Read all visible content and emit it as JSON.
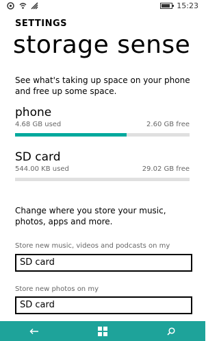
{
  "status": {
    "time": "15:23",
    "icons": [
      "notification-icon",
      "wifi-icon",
      "signal-icon",
      "battery-icon"
    ]
  },
  "header": {
    "app": "SETTINGS",
    "title": "storage sense"
  },
  "intro": "See what's taking up space on your phone and free up some space.",
  "storage": [
    {
      "name": "phone",
      "used": "4.68 GB used",
      "free": "2.60 GB free",
      "used_fraction": 0.64
    },
    {
      "name": "SD card",
      "used": "544.00 KB used",
      "free": "29.02 GB free",
      "used_fraction": 0.0
    }
  ],
  "change_text": "Change where you store your music, photos, apps and more.",
  "settings": [
    {
      "label": "Store new music, videos and podcasts on my",
      "value": "SD card"
    },
    {
      "label": "Store new photos on my",
      "value": "SD card"
    }
  ],
  "nav": {
    "icons": [
      "back-icon",
      "windows-icon",
      "search-icon"
    ]
  },
  "colors": {
    "accent": "#1ea39a",
    "bar_fill": "#00a99d",
    "bar_track": "#e0e0e0"
  }
}
